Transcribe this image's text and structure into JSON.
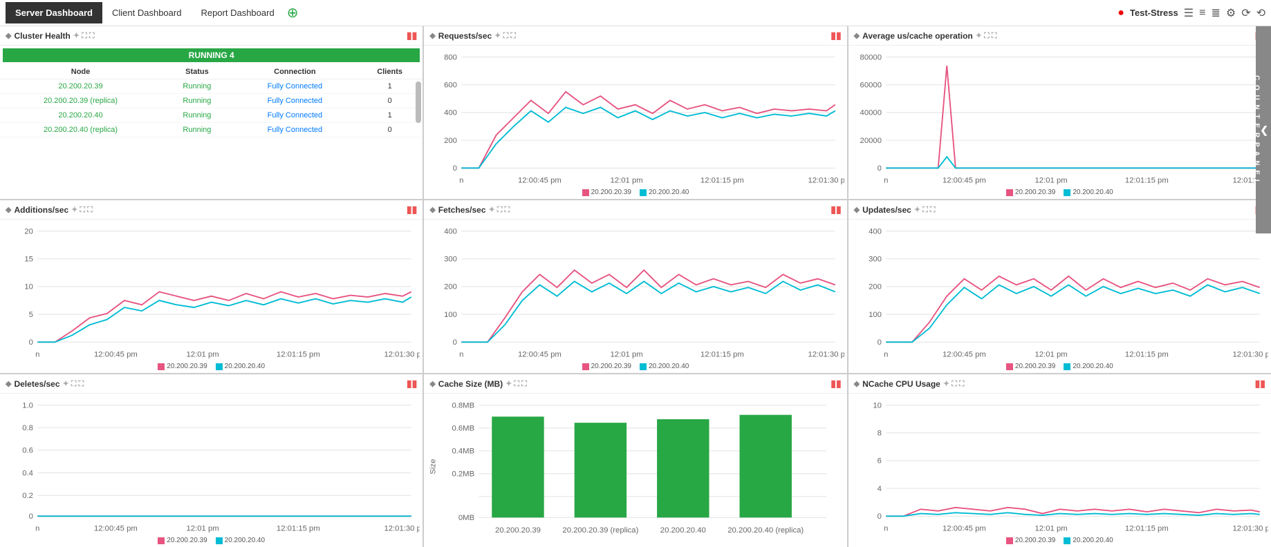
{
  "nav": {
    "active_tab": "Server Dashboard",
    "tabs": [
      "Client Dashboard",
      "Report Dashboard"
    ],
    "add_label": "+",
    "brand": "Test-Stress"
  },
  "cluster": {
    "title": "Cluster Health",
    "status": "RUNNING 4",
    "columns": [
      "Node",
      "Status",
      "Connection",
      "Clients"
    ],
    "rows": [
      {
        "node": "20.200.20.39",
        "status": "Running",
        "connection": "Fully Connected",
        "clients": "1"
      },
      {
        "node": "20.200.20.39 (replica)",
        "status": "Running",
        "connection": "Fully Connected",
        "clients": "0"
      },
      {
        "node": "20.200.20.40",
        "status": "Running",
        "connection": "Fully Connected",
        "clients": "1"
      },
      {
        "node": "20.200.20.40 (replica)",
        "status": "Running",
        "connection": "Fully Connected",
        "clients": "0"
      }
    ]
  },
  "panels": {
    "requests": {
      "title": "Requests/sec",
      "y_max": 800,
      "y_ticks": [
        0,
        200,
        400,
        600,
        800
      ]
    },
    "avg_cache": {
      "title": "Average us/cache operation",
      "y_max": 80000,
      "y_ticks": [
        0,
        20000,
        40000,
        60000,
        80000
      ]
    },
    "additions": {
      "title": "Additions/sec",
      "y_max": 20,
      "y_ticks": [
        0,
        5,
        10,
        15,
        20
      ]
    },
    "fetches": {
      "title": "Fetches/sec",
      "y_max": 400,
      "y_ticks": [
        0,
        100,
        200,
        300,
        400
      ]
    },
    "updates": {
      "title": "Updates/sec",
      "y_max": 400,
      "y_ticks": [
        0,
        100,
        200,
        300,
        400
      ]
    },
    "deletes": {
      "title": "Deletes/sec",
      "y_max": 1.0,
      "y_ticks": [
        0,
        0.2,
        0.4,
        0.6,
        0.8,
        1.0
      ]
    },
    "cache_size": {
      "title": "Cache Size (MB)",
      "y_axis_title": "Size",
      "y_ticks": [
        "0MB",
        "0.2MB",
        "0.4MB",
        "0.6MB",
        "0.8MB"
      ],
      "x_labels": [
        "20.200.20.39",
        "20.200.20.39 (replica)",
        "20.200.20.40",
        "20.200.20.40 (replica)"
      ]
    },
    "ncache_cpu": {
      "title": "NCache CPU Usage",
      "y_max": 10,
      "y_ticks": [
        0,
        2,
        4,
        6,
        8,
        10
      ]
    }
  },
  "legend": {
    "node1": "20.200.20.39",
    "node2": "20.200.20.40"
  },
  "time_labels": [
    "n",
    "12:00:45 pm",
    "12:01 pm",
    "12:01:15 pm",
    "12:01:30 p"
  ],
  "counter_panel": "COUNTER PANEL"
}
